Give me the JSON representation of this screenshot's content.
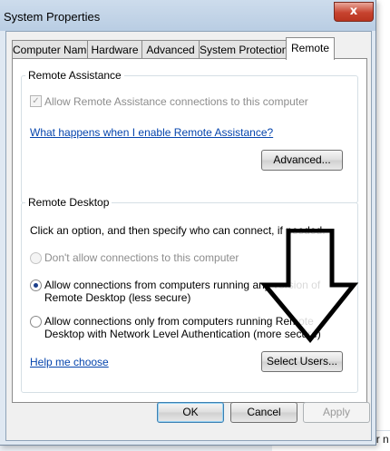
{
  "background": {
    "bottom_text": "Full computer n"
  },
  "window": {
    "title": "System Properties",
    "close_glyph": "x"
  },
  "tabs": [
    {
      "label": "Computer Name"
    },
    {
      "label": "Hardware"
    },
    {
      "label": "Advanced"
    },
    {
      "label": "System Protection"
    },
    {
      "label": "Remote",
      "active": true
    }
  ],
  "remote_assistance": {
    "group_title": "Remote Assistance",
    "allow_label": "Allow Remote Assistance connections to this computer",
    "allow_checked": true,
    "allow_disabled": true,
    "help_link": "What happens when I enable Remote Assistance?",
    "advanced_button": "Advanced..."
  },
  "remote_desktop": {
    "group_title": "Remote Desktop",
    "instructions": "Click an option, and then specify who can connect, if needed.",
    "options": [
      {
        "line1": "Don't allow connections to this computer",
        "line2": "",
        "selected": false,
        "disabled": true
      },
      {
        "line1": "Allow connections from computers running any version of",
        "line2": "Remote Desktop (less secure)",
        "selected": true,
        "disabled": false
      },
      {
        "line1": "Allow connections only from computers running Remote",
        "line2": "Desktop with Network Level Authentication (more secure)",
        "selected": false,
        "disabled": false
      }
    ],
    "help_link": "Help me choose",
    "select_users_button": "Select Users..."
  },
  "footer": {
    "ok": "OK",
    "cancel": "Cancel",
    "apply": "Apply"
  }
}
